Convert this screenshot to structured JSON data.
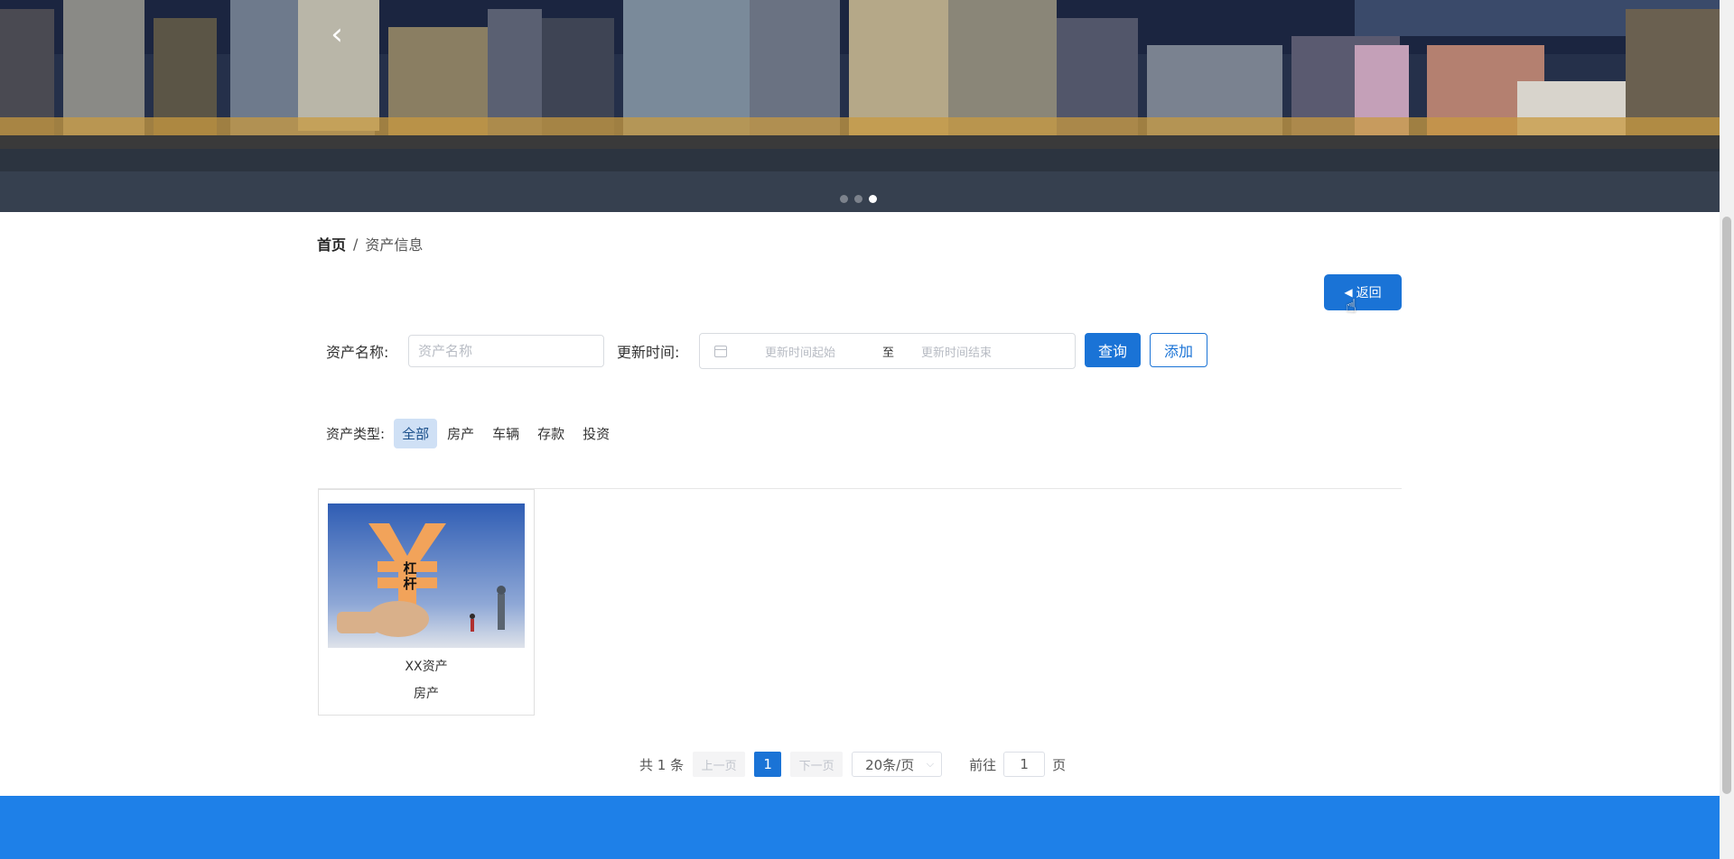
{
  "banner": {
    "prev_icon": "chevron-left-icon",
    "slide_count": 3,
    "active_slide": 3
  },
  "breadcrumb": {
    "home": "首页",
    "separator": "/",
    "current": "资产信息"
  },
  "back_button": {
    "label": "返回",
    "icon": "caret-left-icon"
  },
  "search": {
    "name_label": "资产名称:",
    "name_placeholder": "资产名称",
    "time_label": "更新时间:",
    "start_placeholder": "更新时间起始",
    "range_separator": "至",
    "end_placeholder": "更新时间结束",
    "query_label": "查询",
    "add_label": "添加"
  },
  "type_filter": {
    "label": "资产类型:",
    "items": [
      "全部",
      "房产",
      "车辆",
      "存款",
      "投资"
    ],
    "active": "全部"
  },
  "assets": [
    {
      "name": "XX资产",
      "type": "房产",
      "image_text": "杠杆"
    }
  ],
  "pagination": {
    "total": "共 1 条",
    "prev": "上一页",
    "current_page": "1",
    "next": "下一页",
    "page_size": "20条/页",
    "goto_prefix": "前往",
    "goto_value": "1",
    "goto_suffix": "页"
  },
  "colors": {
    "primary": "#1a73d6",
    "footer": "#1e80e8",
    "active_tag_bg": "#cfe0f5"
  }
}
